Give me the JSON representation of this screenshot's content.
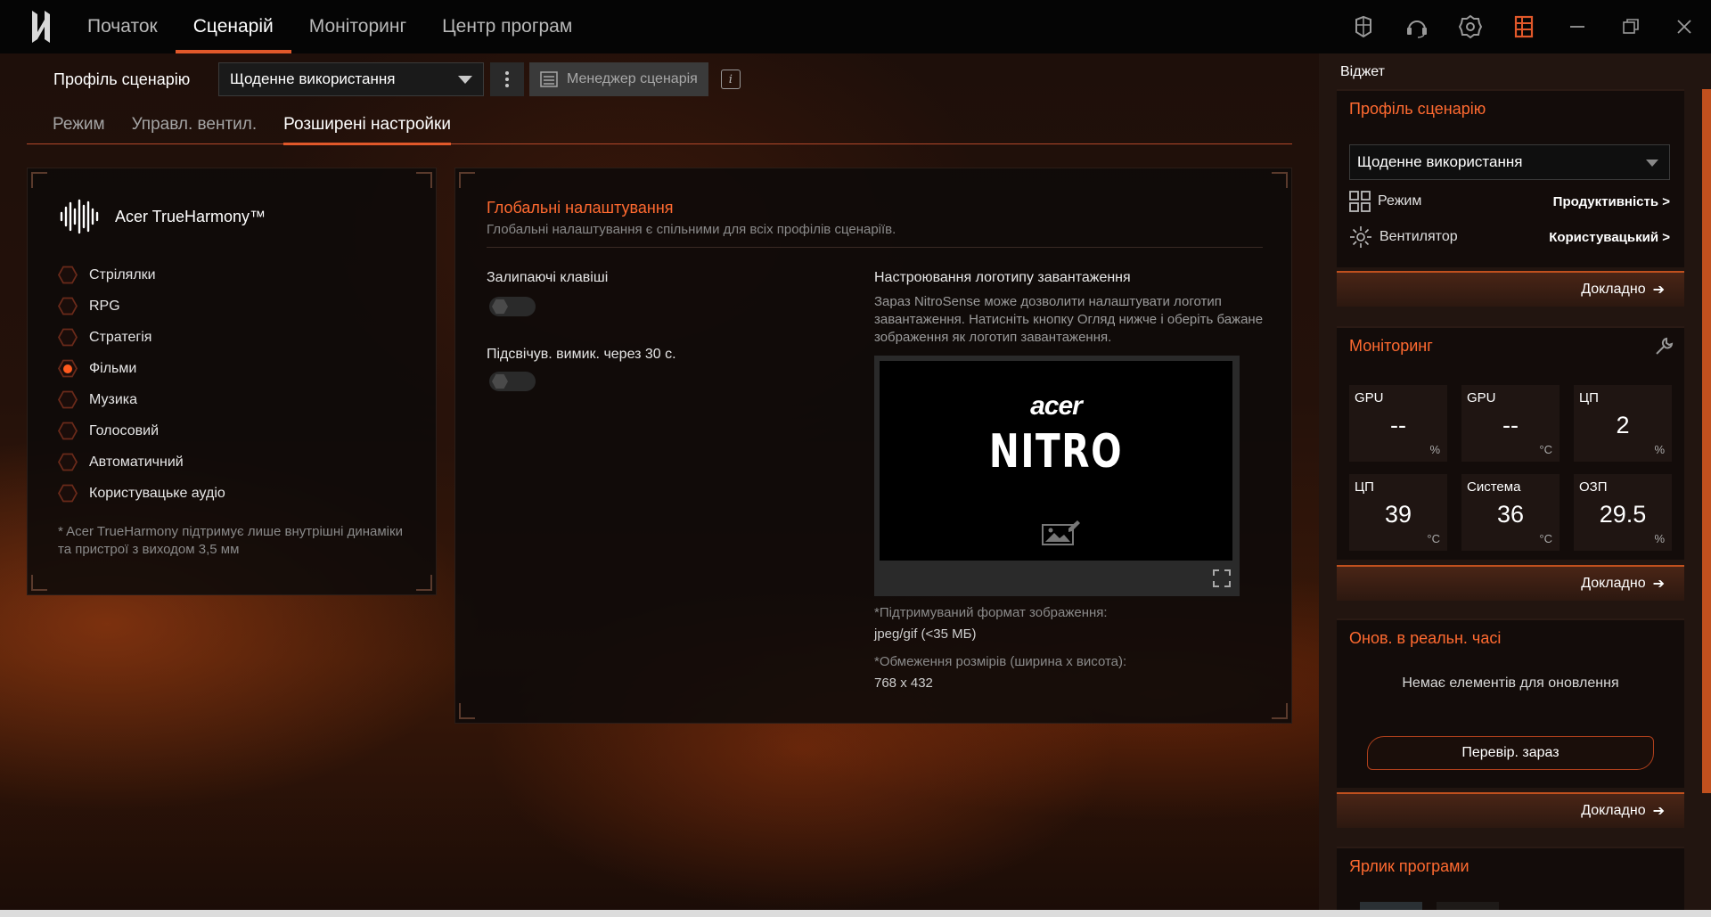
{
  "nav": {
    "items": [
      "Початок",
      "Сценарій",
      "Моніторинг",
      "Центр програм"
    ],
    "active_index": 1,
    "icons": [
      "keyboard-lighting-icon",
      "headset-icon",
      "settings-icon",
      "widget-panel-icon",
      "minimize-icon",
      "restore-icon",
      "close-icon"
    ]
  },
  "scenario": {
    "label": "Профіль сценарію",
    "profile": "Щоденне використання",
    "manager_label": "Менеджер сценарія"
  },
  "tabs": {
    "items": [
      "Режим",
      "Управл. вентил.",
      "Розширені настройки"
    ],
    "active_index": 2
  },
  "true_harmony": {
    "title": "Acer TrueHarmony™",
    "options": [
      "Стрілялки",
      "RPG",
      "Стратегія",
      "Фільми",
      "Музика",
      "Голосовий",
      "Автоматичний",
      "Користувацьке аудіо"
    ],
    "selected_index": 3,
    "note": "* Acer TrueHarmony підтримує лише внутрішні динаміки та пристрої з виходом 3,5 мм"
  },
  "global": {
    "title": "Глобальні налаштування",
    "subtitle": "Глобальні налаштування є спільними для всіх профілів сценаріїв.",
    "sticky_keys_label": "Залипаючі клавіші",
    "sticky_keys_on": false,
    "backlight_label": "Підсвічув. вимик. через 30 с.",
    "backlight_on": false,
    "boot_logo_title": "Настроювання логотипу завантаження",
    "boot_logo_desc": "Зараз NitroSense може дозволити налаштувати логотип завантаження. Натисніть кнопку Огляд нижче і оберіть бажане зображення як логотип завантаження.",
    "preview_brand": "acer",
    "preview_product": "NITRO",
    "format_label": "*Підтримуваний формат зображення:",
    "format_value": "jpeg/gif (<35 МБ)",
    "size_label": "*Обмеження розмірів (ширина x висота):",
    "size_value": "768 x 432"
  },
  "widget": {
    "title": "Віджет",
    "profile_card": {
      "title": "Профіль сценарію",
      "profile": "Щоденне використання",
      "mode_label": "Режим",
      "mode_value": "Продуктивність",
      "fan_label": "Вентилятор",
      "fan_value": "Користувацький",
      "more": "Докладно"
    },
    "monitor_card": {
      "title": "Моніторинг",
      "tiles": [
        {
          "label": "GPU",
          "value": "--",
          "unit": "%"
        },
        {
          "label": "GPU",
          "value": "--",
          "unit": "°C"
        },
        {
          "label": "ЦП",
          "value": "2",
          "unit": "%"
        },
        {
          "label": "ЦП",
          "value": "39",
          "unit": "°C"
        },
        {
          "label": "Система",
          "value": "36",
          "unit": "°C"
        },
        {
          "label": "ОЗП",
          "value": "29.5",
          "unit": "%"
        }
      ],
      "more": "Докладно"
    },
    "updates_card": {
      "title": "Онов. в реальн. часі",
      "empty": "Немає елементів для оновлення",
      "check_button": "Перевір. зараз",
      "more": "Докладно"
    },
    "shortcut_card": {
      "title": "Ярлик програми"
    }
  },
  "colors": {
    "accent": "#e1582a",
    "accent_text": "#ff6a30"
  }
}
